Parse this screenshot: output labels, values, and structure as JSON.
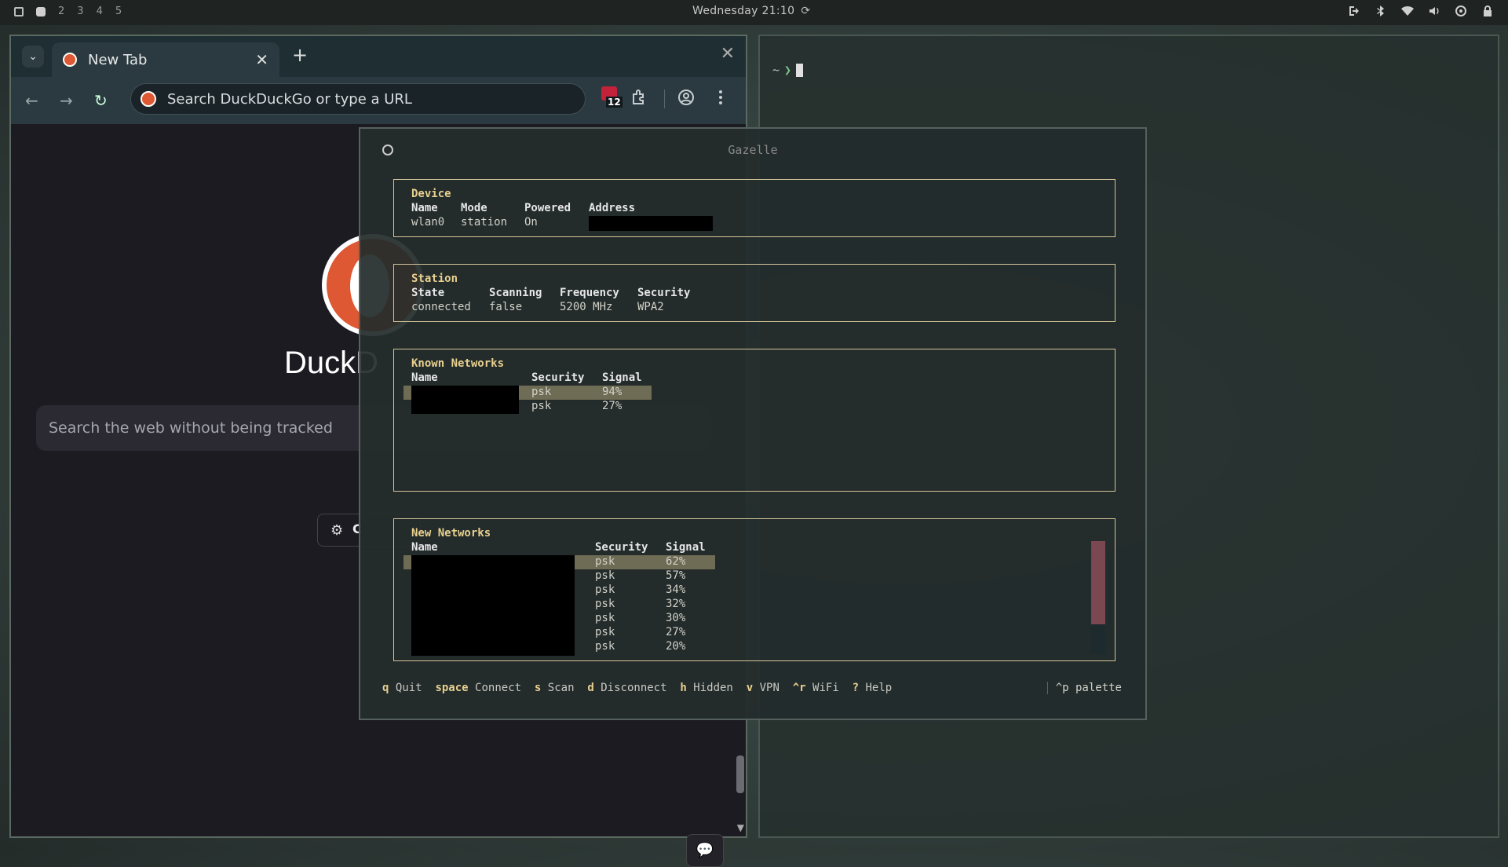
{
  "topbar": {
    "workspaces": [
      "2",
      "3",
      "4",
      "5"
    ],
    "clock": "Wednesday 21:10"
  },
  "browser": {
    "tab_title": "New Tab",
    "omnibox_placeholder": "Search DuckDuckGo or type a URL",
    "extension_badge": "12",
    "page": {
      "logo_text": "DuckD",
      "search_placeholder": "Search the web without being tracked",
      "chip_text": "C"
    }
  },
  "terminal": {
    "prompt_dir": "~",
    "prompt_arrow": "❯"
  },
  "gazelle": {
    "title": "Gazelle",
    "device": {
      "title": "Device",
      "headers": [
        "Name",
        "Mode",
        "Powered",
        "Address"
      ],
      "values": [
        "wlan0",
        "station",
        "On",
        ""
      ]
    },
    "station": {
      "title": "Station",
      "headers": [
        "State",
        "Scanning",
        "Frequency",
        "Security"
      ],
      "values": [
        "connected",
        "false",
        "5200 MHz",
        "WPA2"
      ]
    },
    "known_networks": {
      "title": "Known Networks",
      "headers": [
        "Name",
        "Security",
        "Signal"
      ],
      "rows": [
        {
          "security": "psk",
          "signal": "94%"
        },
        {
          "security": "psk",
          "signal": "27%"
        }
      ]
    },
    "new_networks": {
      "title": "New Networks",
      "headers": [
        "Name",
        "Security",
        "Signal"
      ],
      "rows": [
        {
          "security": "psk",
          "signal": "62%"
        },
        {
          "security": "psk",
          "signal": "57%"
        },
        {
          "security": "psk",
          "signal": "34%"
        },
        {
          "security": "psk",
          "signal": "32%"
        },
        {
          "security": "psk",
          "signal": "30%"
        },
        {
          "security": "psk",
          "signal": "27%"
        },
        {
          "security": "psk",
          "signal": "20%"
        }
      ]
    },
    "footer": [
      {
        "key": "q",
        "label": "Quit"
      },
      {
        "key": "space",
        "label": "Connect"
      },
      {
        "key": "s",
        "label": "Scan"
      },
      {
        "key": "d",
        "label": "Disconnect"
      },
      {
        "key": "h",
        "label": "Hidden"
      },
      {
        "key": "v",
        "label": "VPN"
      },
      {
        "key": "^r",
        "label": "WiFi"
      },
      {
        "key": "?",
        "label": "Help"
      }
    ],
    "palette": "^p palette"
  }
}
